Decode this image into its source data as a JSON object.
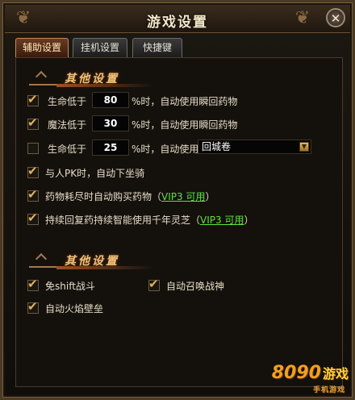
{
  "window": {
    "title": "游戏设置"
  },
  "tabs": [
    {
      "label": "辅助设置",
      "active": true
    },
    {
      "label": "挂机设置",
      "active": false
    },
    {
      "label": "快捷键",
      "active": false
    }
  ],
  "section1": {
    "title": "其他设置",
    "hp_row": {
      "checked": true,
      "label": "生命低于",
      "value": "80",
      "suffix": "%时，自动使用瞬回药物"
    },
    "mp_row": {
      "checked": true,
      "label": "魔法低于",
      "value": "30",
      "suffix": "%时，自动使用瞬回药物"
    },
    "scroll_row": {
      "checked": false,
      "label": "生命低于",
      "value": "25",
      "suffix": "%时，自动使用",
      "select_value": "回城卷"
    },
    "pk_row": {
      "checked": true,
      "label": "与人PK时，自动下坐骑"
    },
    "buy_row": {
      "checked": true,
      "label": "药物耗尽时自动购买药物",
      "paren_open": "（",
      "vip": "VIP3 可用",
      "paren_close": "）"
    },
    "lingzhi_row": {
      "checked": true,
      "label": "持续回复药持续智能使用千年灵芝",
      "paren_open": "（",
      "vip": "VIP3 可用",
      "paren_close": "）"
    }
  },
  "section2": {
    "title": "其他设置",
    "no_shift": {
      "checked": true,
      "label": "免shift战斗"
    },
    "summon": {
      "checked": true,
      "label": "自动召唤战神"
    },
    "firewall": {
      "checked": true,
      "label": "自动火焰壁垒"
    }
  },
  "watermark": {
    "brand": "8090",
    "suffix": "游戏",
    "sub": "手机游戏"
  },
  "colors": {
    "accent": "#f0c27a",
    "vip_green": "#5fe23a",
    "active_tab": "#6a3a24"
  }
}
